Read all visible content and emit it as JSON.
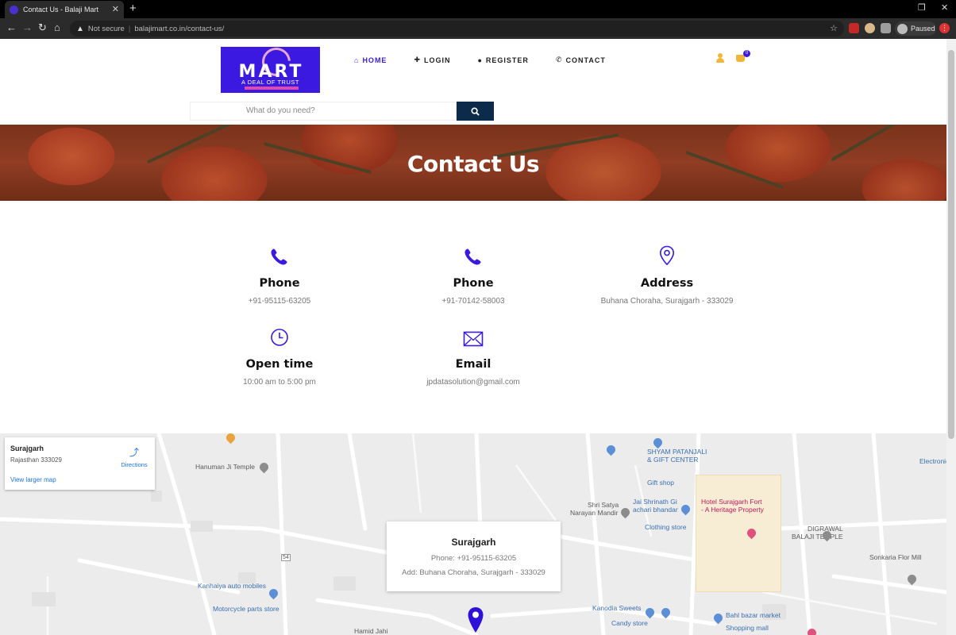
{
  "browser": {
    "tab_title": "Contact Us - Balaji Mart",
    "url_warning": "Not secure",
    "url": "balajimart.co.in/contact-us/",
    "profile_label": "Paused"
  },
  "header": {
    "logo": {
      "word": "MART",
      "tagline": "A DEAL OF TRUST"
    },
    "nav": [
      {
        "label": "HOME",
        "icon": "home-icon"
      },
      {
        "label": "LOGIN",
        "icon": "login-icon"
      },
      {
        "label": "REGISTER",
        "icon": "user-icon"
      },
      {
        "label": "CONTACT",
        "icon": "phone-icon"
      }
    ],
    "cart_count": "0",
    "search": {
      "placeholder": "What do you need?"
    }
  },
  "banner": {
    "title": "Contact Us"
  },
  "contact": {
    "items": [
      {
        "label": "Phone",
        "value": "+91-95115-63205",
        "icon": "phone-icon"
      },
      {
        "label": "Phone",
        "value": "+91-70142-58003",
        "icon": "phone-icon"
      },
      {
        "label": "Address",
        "value": "Buhana Choraha, Surajgarh - 333029",
        "icon": "location-pin-icon"
      },
      {
        "label": "Open time",
        "value": "10:00 am to 5:00 pm",
        "icon": "clock-icon"
      },
      {
        "label": "Email",
        "value": "jpdatasolution@gmail.com",
        "icon": "envelope-icon"
      }
    ]
  },
  "map": {
    "place_card": {
      "title": "Surajgarh",
      "address": "Rajasthan 333029",
      "directions": "Directions",
      "larger_map": "View larger map"
    },
    "info": {
      "title": "Surajgarh",
      "phone": "Phone: +91-95115-63205",
      "address": "Add: Buhana Choraha, Surajgarh - 333029"
    },
    "labels": {
      "hanuman": "Hanuman Ji Temple",
      "shyam1": "SHYAM PATANJALI",
      "shyam2": "& GIFT CENTER",
      "shyam3": "Gift shop",
      "shri_satya1": "Shri Satya",
      "shri_satya2": "Narayan Mandir",
      "jai1": "Jai Shrinath Gi",
      "jai2": "achari bhandar",
      "jai3": "Clothing store",
      "hotel1": "Hotel Surajgarh Fort",
      "hotel2": "- A Heritage Property",
      "digrawal1": "DIGRAWAL",
      "digrawal2": "BALAJI TEMPLE",
      "sonkaria": "Sonkaria Flor Mill",
      "electronics": "Electronics",
      "kanhaiya1": "Kanhaiya auto mobiles",
      "kanhaiya2": "Motorcycle parts store",
      "kanodia1": "Kanodia Sweets",
      "kanodia2": "Candy store",
      "bahl1": "Bahl bazar market",
      "bahl2": "Shopping mall",
      "hamid": "Hamid Jahi",
      "road_no": "54"
    }
  },
  "colors": {
    "brand": "#3b19e0",
    "accent_yellow": "#f0b63a",
    "search_button": "#0c2a4a"
  }
}
